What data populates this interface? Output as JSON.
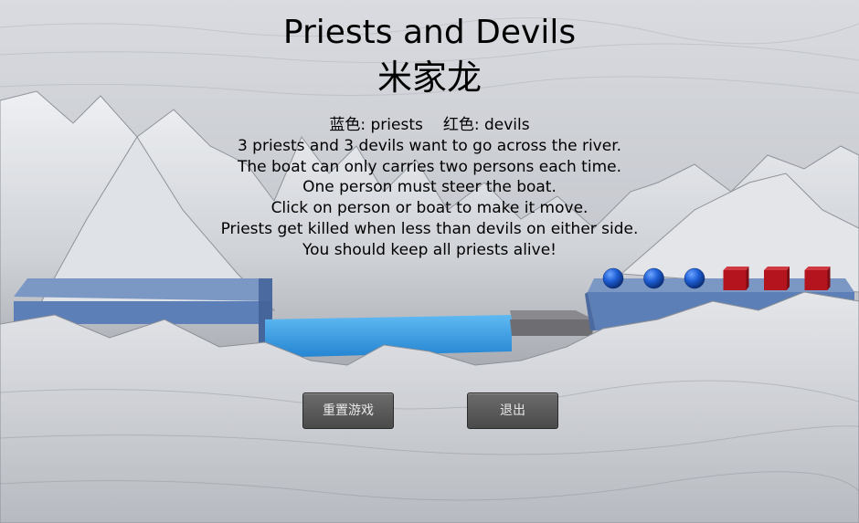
{
  "title": "Priests and Devils",
  "author": "米家龙",
  "legend": {
    "blue_label": "蓝色: priests",
    "red_label": "红色: devils"
  },
  "instructions": [
    "3 priests and 3 devils want to go across the river.",
    "The boat can only carries two persons each time.",
    "One person must steer the boat.",
    "Click on person or boat to make it move.",
    "Priests get killed when less than devils on either side.",
    "You should keep all priests alive!"
  ],
  "buttons": {
    "reset": "重置游戏",
    "quit": "退出"
  },
  "game_state": {
    "right_bank": {
      "priests": 3,
      "devils": 3
    },
    "left_bank": {
      "priests": 0,
      "devils": 0
    },
    "boat_side": "right"
  },
  "colors": {
    "priest": "#1e5fd6",
    "devil": "#b3141e",
    "water": "#3aa0e8",
    "bank": "#5b7fb6",
    "boat": "#6e6e72"
  }
}
